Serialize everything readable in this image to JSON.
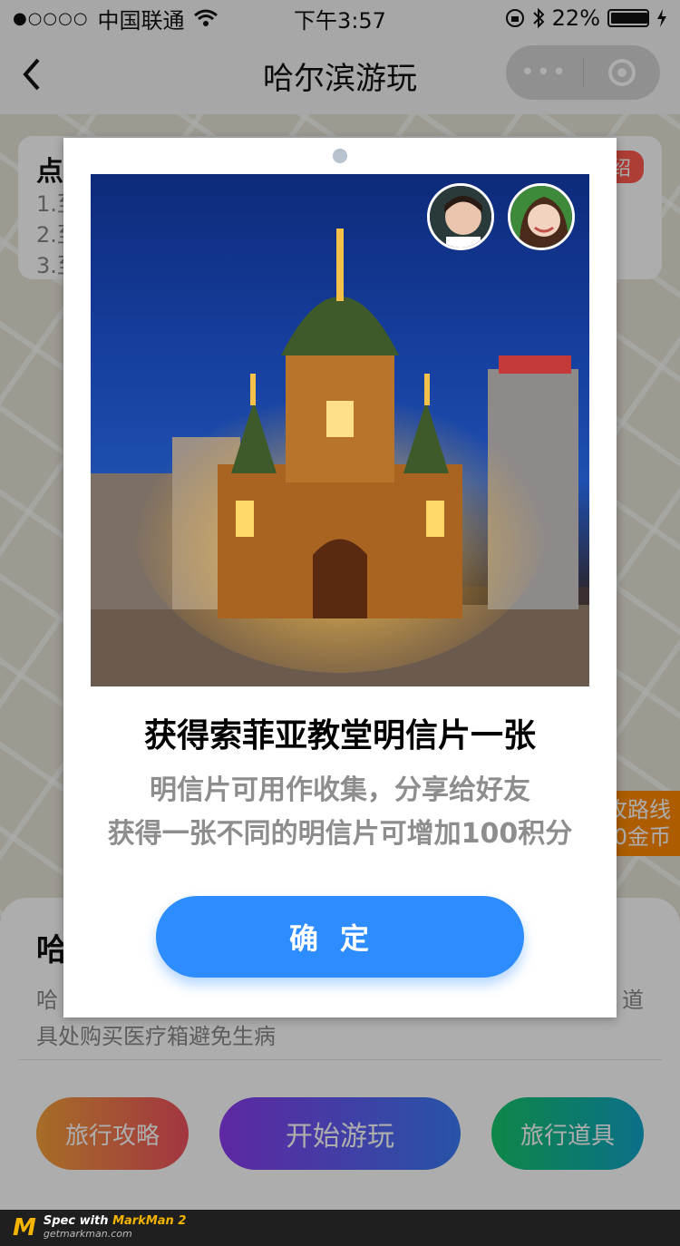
{
  "status_bar": {
    "signal": "●○○○○",
    "carrier": "中国联通",
    "time": "下午3:57",
    "battery_text": "22%"
  },
  "nav": {
    "back_icon": "chevron-left-icon",
    "title": "哈尔滨游玩",
    "more_label": "•••"
  },
  "info_card": {
    "title": "点",
    "lines": [
      "1.至",
      "2.至",
      "3.至"
    ],
    "tag": "绍"
  },
  "side_tag": {
    "line1": "攻路线",
    "line2": "0金币"
  },
  "bottom_panel": {
    "title": "哈",
    "desc_line1": "哈",
    "desc_line1_right": "道",
    "desc_line2": "具处购买医疗箱避免生病",
    "buttons": {
      "guide": "旅行攻略",
      "start": "开始游玩",
      "props": "旅行道具"
    }
  },
  "modal": {
    "title": "获得索菲亚教堂明信片一张",
    "desc_line1": "明信片可用作收集，分享给好友",
    "desc_line2": "获得一张不同的明信片可增加100积分",
    "confirm_label": "确定"
  },
  "footer": {
    "logo": "M",
    "spec_text": "Spec with",
    "brand": "MarkMan 2",
    "url": "getmarkman.com"
  },
  "colors": {
    "primary_button": "#2d8cff",
    "title_text": "#000000",
    "desc_text": "#8d8d8d",
    "modal_bg": "#ffffff"
  }
}
